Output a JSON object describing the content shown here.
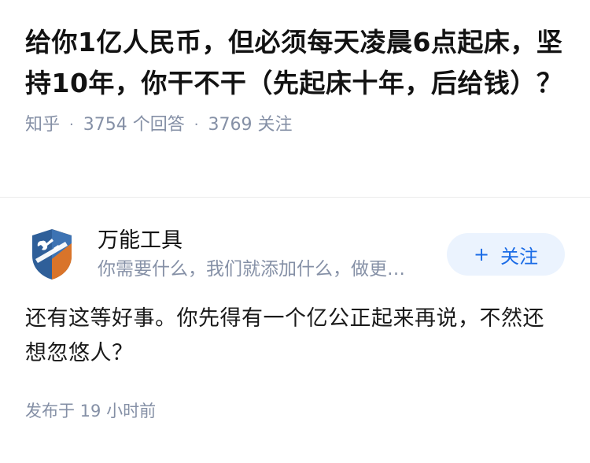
{
  "question": {
    "title": "给你1亿人民币，但必须每天凌晨6点起床，坚持10年，你干不干（先起床十年，后给钱）？",
    "source": "知乎",
    "answer_count": "3754 个回答",
    "follower_count": "3769 关注"
  },
  "answer": {
    "author_name": "万能工具",
    "author_bio": "你需要什么，我们就添加什么，做更好用的工具",
    "follow_button": "关注",
    "content": "还有这等好事。你先得有一个亿公正起来再说，不然还想忽悠人？",
    "published": "发布于 19 小时前"
  },
  "colors": {
    "accent": "#1a6be6",
    "follow_bg": "#ebf3fe",
    "meta_text": "#8590a6"
  },
  "icons": {
    "avatar": "shield-wrench-logo",
    "follow": "plus-icon"
  }
}
